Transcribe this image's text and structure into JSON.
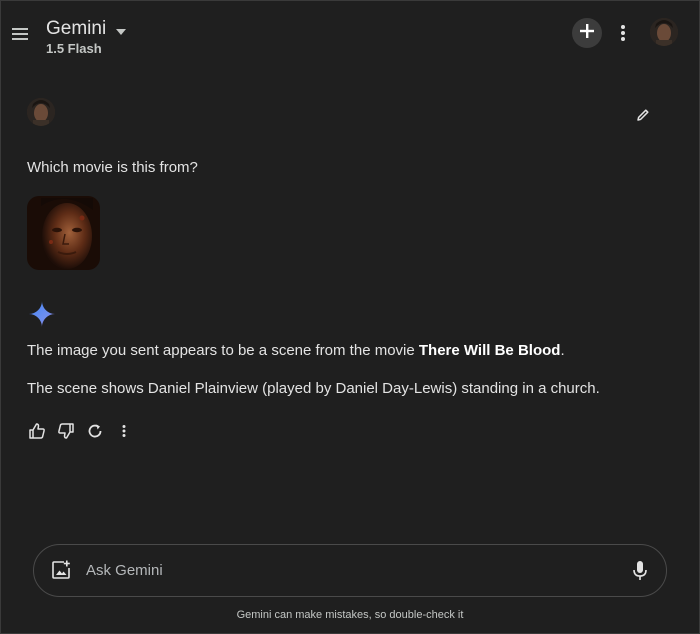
{
  "header": {
    "title": "Gemini",
    "model": "1.5 Flash",
    "icons": [
      "menu-icon",
      "chevron-down-icon",
      "plus-icon",
      "more-vert-icon",
      "avatar"
    ]
  },
  "conversation": {
    "user_message": "Which movie is this from?",
    "response": {
      "p1_prefix": "The image you sent appears to be a scene from the movie ",
      "p1_bold": "There Will Be Blood",
      "p1_suffix": ".",
      "p2": "The scene shows Daniel Plainview (played by Daniel Day-Lewis) standing in a church."
    },
    "response_actions": [
      "thumb-up-icon",
      "thumb-down-icon",
      "regenerate-icon",
      "more-vert-icon"
    ]
  },
  "input": {
    "placeholder": "Ask Gemini",
    "value": ""
  },
  "footer": {
    "disclaimer": "Gemini can make mistakes, so double-check it"
  },
  "colors": {
    "background": "#1f1f1f",
    "text": "#e3e3e3",
    "spark_blue": "#4285f4",
    "spark_purple": "#9b72cb"
  }
}
